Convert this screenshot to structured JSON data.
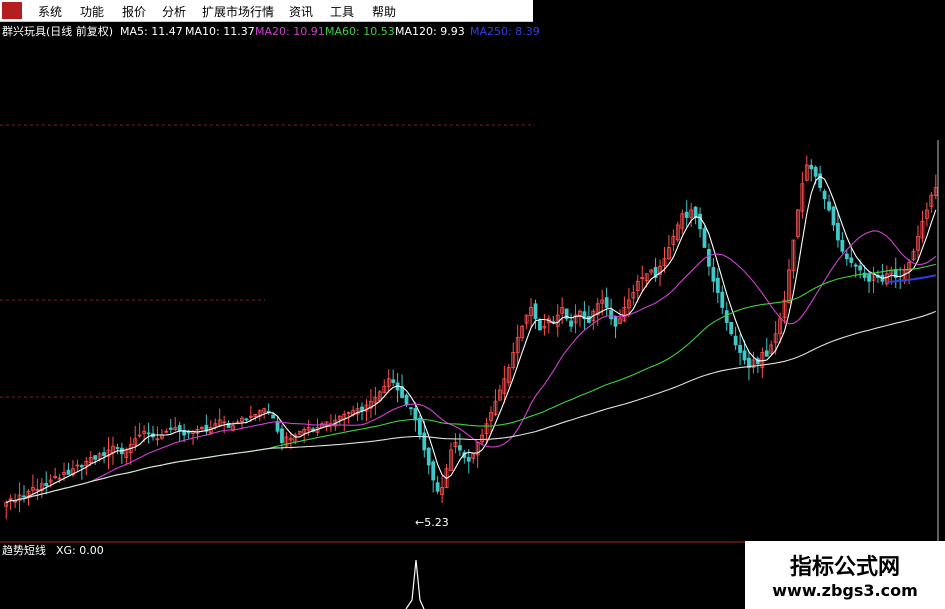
{
  "menu": {
    "logo_text": "",
    "items": [
      "系统",
      "功能",
      "报价",
      "分析",
      "扩展市场行情",
      "资讯",
      "工具",
      "帮助"
    ]
  },
  "header": {
    "stock": "群兴玩具(日线 前复权)",
    "ma_items": [
      {
        "label": "MA5: 11.47",
        "color": "#ffffff"
      },
      {
        "label": "MA10: 11.37",
        "color": "#ffffff"
      },
      {
        "label": "MA20: 10.91",
        "color": "#d040d0"
      },
      {
        "label": "MA60: 10.53",
        "color": "#40d040"
      },
      {
        "label": "MA120: 9.93",
        "color": "#ffffff"
      },
      {
        "label": "MA250: 8.39",
        "color": "#3040e0"
      }
    ]
  },
  "indicator": {
    "title": "趋势短线",
    "xg_text": "XG: 0.00"
  },
  "watermark": {
    "title": "指标公式网",
    "url": "www.zbgs3.com"
  },
  "chart_data": {
    "type": "candlestick",
    "annotation": "←5.23",
    "colors": {
      "up": "#ff5050",
      "down": "#40c8c8",
      "ma5": "#ffffff",
      "ma20": "#d040d0",
      "ma60": "#40d040",
      "ma120": "#e0e0e0",
      "ma250": "#3040e0"
    },
    "close": [
      5.6,
      5.7,
      5.65,
      5.8,
      5.75,
      5.9,
      6.0,
      5.95,
      6.1,
      6.05,
      6.2,
      6.3,
      6.25,
      6.4,
      6.35,
      6.5,
      6.6,
      6.55,
      6.7,
      6.8,
      6.75,
      6.9,
      6.85,
      7.0,
      7.1,
      7.05,
      6.9,
      7.0,
      7.15,
      7.3,
      7.4,
      7.5,
      7.45,
      7.35,
      7.3,
      7.4,
      7.5,
      7.55,
      7.6,
      7.5,
      7.4,
      7.45,
      7.5,
      7.55,
      7.6,
      7.5,
      7.6,
      7.7,
      7.8,
      7.75,
      7.6,
      7.65,
      7.75,
      7.85,
      7.8,
      7.9,
      7.95,
      8.05,
      8.1,
      8.0,
      7.85,
      7.5,
      7.2,
      7.35,
      7.3,
      7.4,
      7.5,
      7.55,
      7.6,
      7.5,
      7.6,
      7.7,
      7.75,
      7.7,
      7.8,
      7.9,
      7.95,
      8.0,
      8.05,
      8.1,
      8.05,
      8.2,
      8.3,
      8.4,
      8.55,
      8.7,
      8.9,
      8.8,
      8.6,
      8.4,
      8.2,
      8.1,
      7.8,
      7.4,
      7.0,
      6.6,
      6.2,
      5.9,
      6.0,
      6.5,
      7.0,
      7.2,
      7.0,
      6.8,
      6.7,
      6.9,
      7.2,
      7.4,
      7.7,
      8.0,
      8.3,
      8.6,
      8.9,
      9.2,
      9.6,
      10.0,
      10.3,
      10.6,
      10.8,
      10.5,
      10.2,
      10.3,
      10.5,
      10.4,
      10.6,
      10.8,
      10.5,
      10.3,
      10.6,
      10.7,
      10.5,
      10.4,
      10.7,
      10.9,
      11.0,
      10.8,
      10.5,
      10.3,
      10.5,
      10.8,
      11.0,
      11.2,
      11.5,
      11.6,
      11.7,
      11.8,
      11.6,
      11.9,
      12.1,
      12.4,
      12.7,
      13.0,
      13.3,
      13.2,
      13.4,
      13.2,
      12.9,
      12.4,
      11.9,
      11.5,
      11.2,
      10.8,
      10.4,
      10.1,
      9.8,
      9.6,
      9.4,
      9.2,
      9.4,
      9.3,
      9.6,
      9.5,
      9.8,
      10.1,
      10.5,
      11.0,
      11.8,
      12.6,
      13.4,
      14.1,
      14.6,
      14.5,
      14.3,
      14.0,
      13.7,
      13.4,
      13.0,
      12.6,
      12.3,
      12.1,
      12.0,
      11.9,
      11.8,
      11.6,
      11.5,
      11.7,
      11.6,
      11.5,
      11.7,
      11.8,
      11.6,
      11.5,
      11.8,
      12.0,
      12.3,
      12.7,
      13.1,
      13.4,
      13.8,
      14.0
    ]
  }
}
